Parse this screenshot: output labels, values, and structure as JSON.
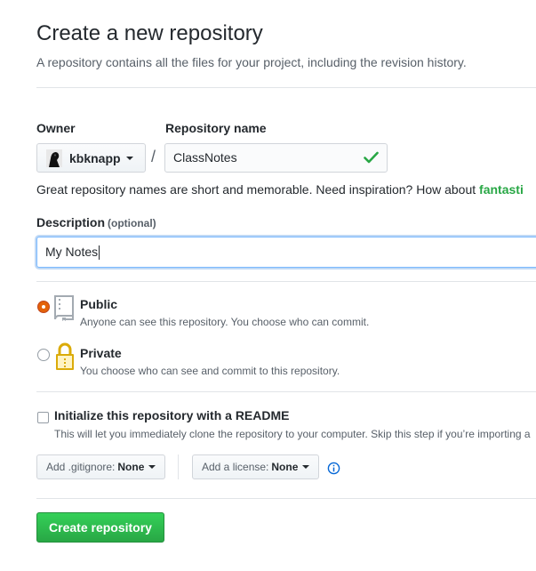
{
  "header": {
    "title": "Create a new repository",
    "subtitle": "A repository contains all the files for your project, including the revision history."
  },
  "owner": {
    "label": "Owner",
    "value": "kbknapp"
  },
  "repo": {
    "label": "Repository name",
    "value": "ClassNotes",
    "separator": "/"
  },
  "hint": {
    "text": "Great repository names are short and memorable. Need inspiration? How about ",
    "suggestion": "fantasti"
  },
  "description": {
    "label": "Description",
    "optional": "(optional)",
    "value": "My Notes"
  },
  "visibility": {
    "public": {
      "title": "Public",
      "desc": "Anyone can see this repository. You choose who can commit.",
      "selected": true
    },
    "private": {
      "title": "Private",
      "desc": "You choose who can see and commit to this repository.",
      "selected": false
    }
  },
  "readme": {
    "title": "Initialize this repository with a README",
    "desc": "This will let you immediately clone the repository to your computer. Skip this step if you’re importing a",
    "checked": false
  },
  "options": {
    "gitignore_label": "Add .gitignore:",
    "gitignore_value": "None",
    "license_label": "Add a license:",
    "license_value": "None"
  },
  "submit": {
    "label": "Create repository"
  },
  "colors": {
    "accent_green": "#28a745",
    "radio_selected": "#e36209",
    "focus_border": "#79b8ff",
    "info_blue": "#0366d6"
  }
}
